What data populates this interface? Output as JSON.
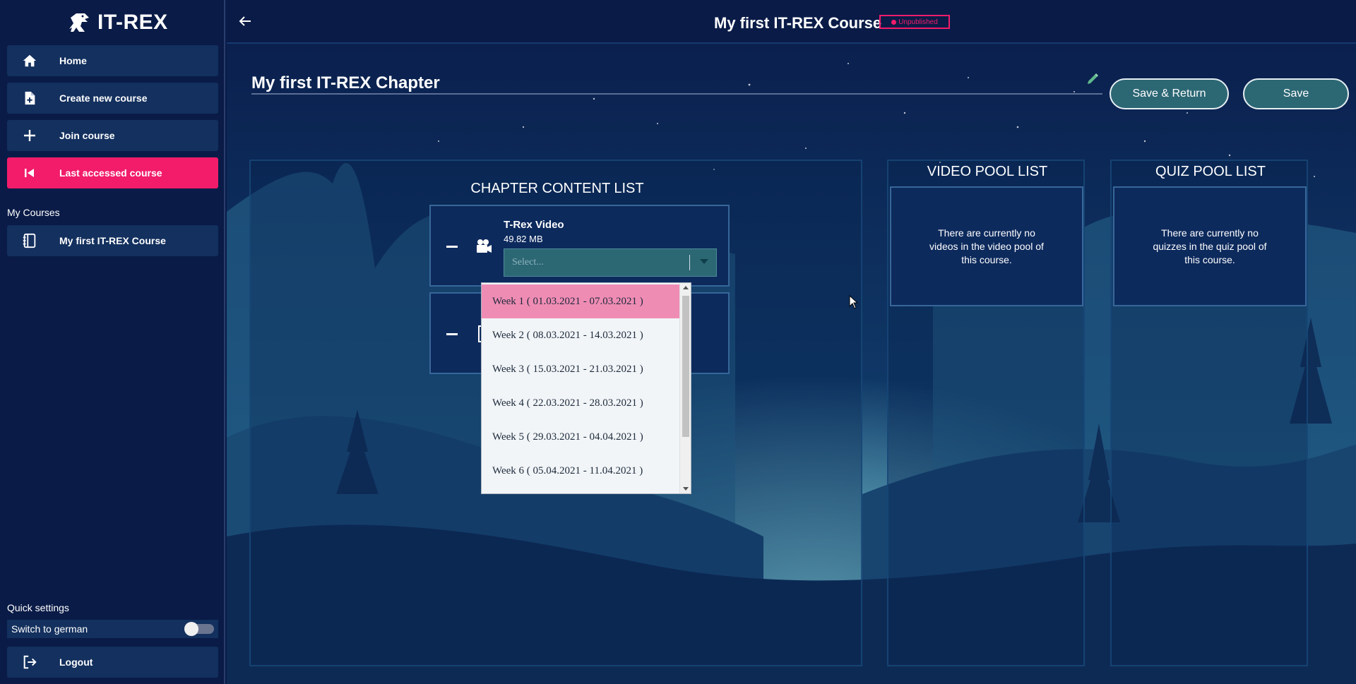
{
  "app": {
    "name": "IT-REX"
  },
  "sidebar": {
    "nav": [
      {
        "label": "Home",
        "icon": "home-icon"
      },
      {
        "label": "Create new course",
        "icon": "file-add-icon"
      },
      {
        "label": "Join course",
        "icon": "plus-icon"
      },
      {
        "label": "Last accessed course",
        "icon": "skip-back-icon",
        "active": true
      }
    ],
    "my_courses_label": "My Courses",
    "courses": [
      {
        "label": "My first IT-REX Course",
        "icon": "notebook-icon"
      }
    ],
    "quick_settings_label": "Quick settings",
    "german_toggle": {
      "label": "Switch to german",
      "on": false
    },
    "logout_label": "Logout"
  },
  "header": {
    "course_title": "My first IT-REX Course",
    "status_badge": "Unpublished"
  },
  "chapter": {
    "title": "My first IT-REX Chapter",
    "save_return_label": "Save & Return",
    "save_label": "Save"
  },
  "content_list": {
    "heading": "CHAPTER CONTENT LIST",
    "items": [
      {
        "name": "T-Rex Video",
        "size": "49.82 MB",
        "icon": "video-camera-icon",
        "select_placeholder": "Select..."
      },
      {
        "icon": "quiz-file-icon"
      }
    ]
  },
  "week_dropdown": {
    "options": [
      "Week 1 ( 01.03.2021 - 07.03.2021 )",
      "Week 2 ( 08.03.2021 - 14.03.2021 )",
      "Week 3 ( 15.03.2021 - 21.03.2021 )",
      "Week 4 ( 22.03.2021 - 28.03.2021 )",
      "Week 5 ( 29.03.2021 - 04.04.2021 )",
      "Week 6 ( 05.04.2021 - 11.04.2021 )"
    ],
    "highlighted_index": 0
  },
  "video_pool": {
    "heading": "VIDEO POOL LIST",
    "empty_message": "There are currently no videos in the video pool of this course."
  },
  "quiz_pool": {
    "heading": "QUIZ POOL LIST",
    "empty_message": "There are currently no quizzes in the quiz pool of this course."
  },
  "colors": {
    "accent_pink": "#f21c6b",
    "teal_button": "#2c6774",
    "sidebar_bg": "#0a1b47",
    "nav_item_bg": "#13305e"
  }
}
